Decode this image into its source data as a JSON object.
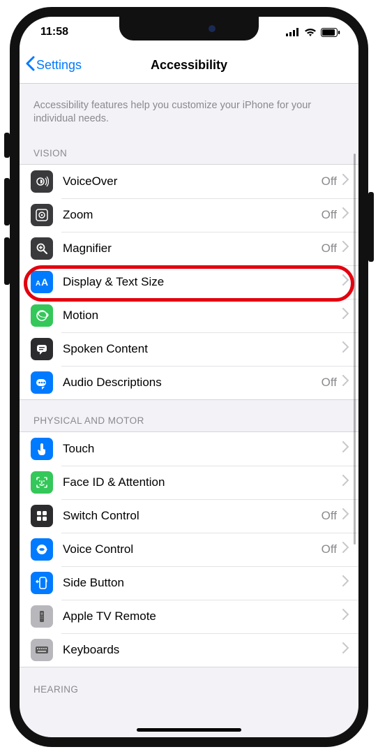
{
  "status": {
    "time": "11:58"
  },
  "nav": {
    "back_label": "Settings",
    "title": "Accessibility"
  },
  "desc": "Accessibility features help you customize your iPhone for your individual needs.",
  "sections": {
    "vision": {
      "header": "VISION",
      "items": [
        {
          "icon": "voiceover-icon",
          "label": "VoiceOver",
          "value": "Off"
        },
        {
          "icon": "zoom-icon",
          "label": "Zoom",
          "value": "Off"
        },
        {
          "icon": "magnifier-icon",
          "label": "Magnifier",
          "value": "Off"
        },
        {
          "icon": "textsize-icon",
          "label": "Display & Text Size",
          "value": ""
        },
        {
          "icon": "motion-icon",
          "label": "Motion",
          "value": ""
        },
        {
          "icon": "spoken-icon",
          "label": "Spoken Content",
          "value": ""
        },
        {
          "icon": "audiodesc-icon",
          "label": "Audio Descriptions",
          "value": "Off"
        }
      ]
    },
    "physical": {
      "header": "PHYSICAL AND MOTOR",
      "items": [
        {
          "icon": "touch-icon",
          "label": "Touch",
          "value": ""
        },
        {
          "icon": "faceid-icon",
          "label": "Face ID & Attention",
          "value": ""
        },
        {
          "icon": "switch-icon",
          "label": "Switch Control",
          "value": "Off"
        },
        {
          "icon": "voicectrl-icon",
          "label": "Voice Control",
          "value": "Off"
        },
        {
          "icon": "sidebtn-icon",
          "label": "Side Button",
          "value": ""
        },
        {
          "icon": "tvremote-icon",
          "label": "Apple TV Remote",
          "value": ""
        },
        {
          "icon": "keyboards-icon",
          "label": "Keyboards",
          "value": ""
        }
      ]
    },
    "hearing": {
      "header": "HEARING"
    }
  },
  "highlight_row_index": 3,
  "colors": {
    "accent": "#007aff",
    "highlight": "#e3000f"
  }
}
